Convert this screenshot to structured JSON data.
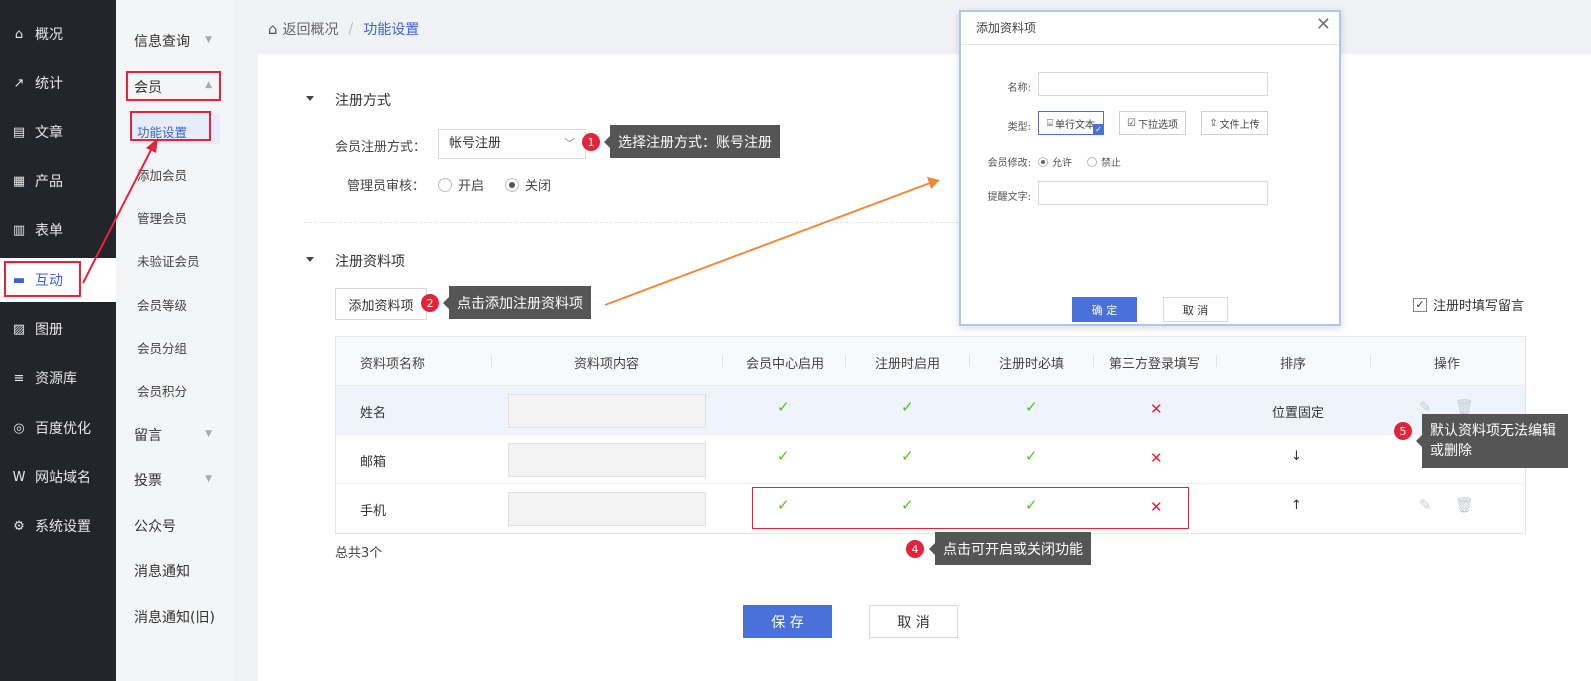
{
  "sidebar": {
    "items": [
      {
        "label": "概况",
        "icon": "home-icon",
        "glyph": "⌂"
      },
      {
        "label": "统计",
        "icon": "chart-icon",
        "glyph": "↗"
      },
      {
        "label": "文章",
        "icon": "article-icon",
        "glyph": "▤"
      },
      {
        "label": "产品",
        "icon": "product-icon",
        "glyph": "▦"
      },
      {
        "label": "表单",
        "icon": "form-icon",
        "glyph": "▥"
      },
      {
        "label": "互动",
        "icon": "chat-icon",
        "glyph": "▬"
      },
      {
        "label": "图册",
        "icon": "album-icon",
        "glyph": "▨"
      },
      {
        "label": "资源库",
        "icon": "database-icon",
        "glyph": "≡"
      },
      {
        "label": "百度优化",
        "icon": "seo-icon",
        "glyph": "◎"
      },
      {
        "label": "网站域名",
        "icon": "domain-icon",
        "glyph": "W"
      },
      {
        "label": "系统设置",
        "icon": "gear-icon",
        "glyph": "⚙"
      }
    ]
  },
  "submenu": {
    "info_query": "信息查询",
    "member": "会员",
    "member_items": [
      "功能设置",
      "添加会员",
      "管理会员",
      "未验证会员",
      "会员等级",
      "会员分组",
      "会员积分"
    ],
    "message": "留言",
    "vote": "投票",
    "official": "公众号",
    "notice": "消息通知",
    "notice_old": "消息通知(旧)"
  },
  "breadcrumb": {
    "back": "返回概况",
    "sep": "/",
    "current": "功能设置"
  },
  "reg_method": {
    "section": "注册方式",
    "method_label": "会员注册方式：",
    "method_value": "帐号注册",
    "audit_label": "管理员审核：",
    "audit_on": "开启",
    "audit_off": "关闭"
  },
  "reg_fields": {
    "section": "注册资料项",
    "add_button": "添加资料项",
    "leave_msg": "注册时填写留言",
    "headers": [
      "资料项名称",
      "资料项内容",
      "会员中心启用",
      "注册时启用",
      "注册时必填",
      "第三方登录填写",
      "排序",
      "操作"
    ],
    "rows": [
      {
        "name": "姓名",
        "center": "✓",
        "reg": "✓",
        "required": "✓",
        "third": "✕",
        "sort": "位置固定"
      },
      {
        "name": "邮箱",
        "center": "✓",
        "reg": "✓",
        "required": "✓",
        "third": "✕",
        "sort": "↓"
      },
      {
        "name": "手机",
        "center": "✓",
        "reg": "✓",
        "required": "✓",
        "third": "✕",
        "sort": "↑"
      }
    ],
    "total": "总共3个"
  },
  "footer": {
    "save": "保 存",
    "cancel": "取 消"
  },
  "tips": {
    "t1_num": "1",
    "t1": "选择注册方式：账号注册",
    "t2_num": "2",
    "t2": "点击添加注册资料项",
    "t4_num": "4",
    "t4": "点击可开启或关闭功能",
    "t5_num": "5",
    "t5_line1": "默认资料项无法编辑",
    "t5_line2": "或删除"
  },
  "dialog": {
    "title": "添加资料项",
    "name_label": "名称:",
    "type_label": "类型:",
    "type_options": [
      "单行文本",
      "下拉选项",
      "文件上传"
    ],
    "edit_label": "会员修改:",
    "edit_allow": "允许",
    "edit_deny": "禁止",
    "hint_label": "提醒文字:",
    "ok": "确 定",
    "cancel": "取 消"
  },
  "colors": {
    "accent": "#4a70d9",
    "annotation_red": "#e5243b",
    "tick_green": "#52c41a",
    "arrow_orange": "#ef8a3a"
  }
}
